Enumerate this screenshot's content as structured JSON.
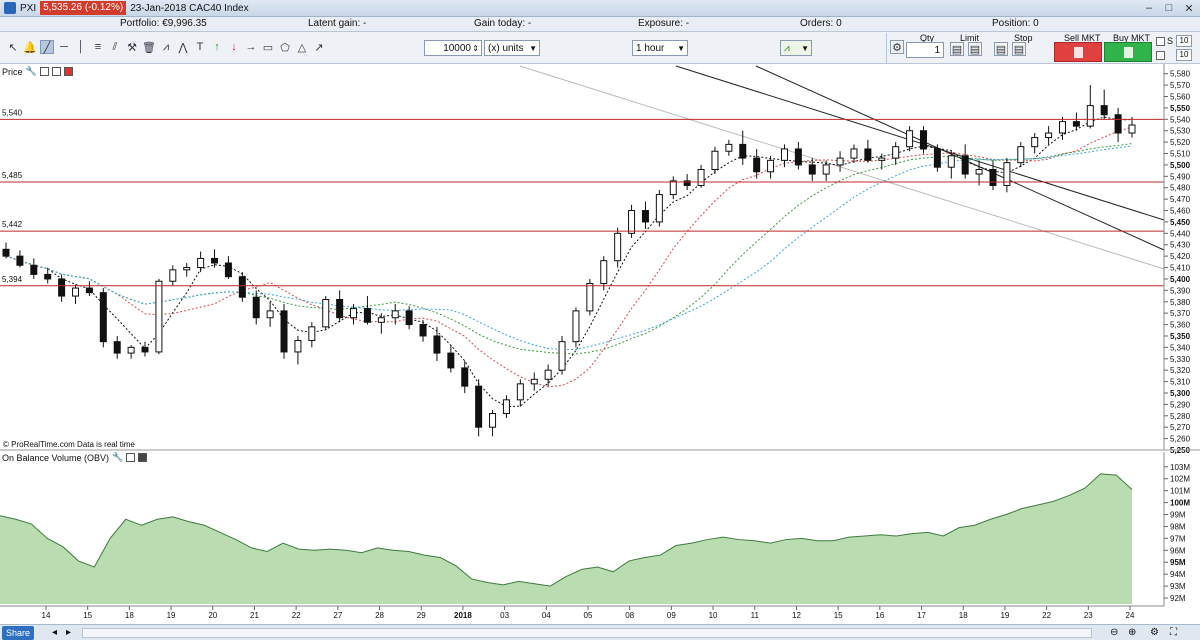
{
  "window": {
    "app_label": "PXI",
    "price_badge": "5,535.26 (-0.12%)",
    "subtitle": "23-Jan-2018 CAC40 Index",
    "controls": [
      "–",
      "□",
      "✕"
    ]
  },
  "portfolio_bar": {
    "portfolio": "Portfolio: €9,996.35",
    "latent_gain": "Latent gain:  -",
    "gain_today": "Gain today:  -",
    "exposure": "Exposure:  -",
    "orders": "Orders: 0",
    "position": "Position: 0"
  },
  "toolbar": {
    "quantity": "10000",
    "units": "(x) units",
    "timeframe": "1 hour",
    "tools": [
      "pointer-icon",
      "alert-bell-icon",
      "trendline-icon",
      "horizontal-line-icon",
      "vertical-line-icon",
      "fibonacci-icon",
      "channel-icon",
      "hammer-icon",
      "delete-icon",
      "zigzag-icon",
      "pattern-icon",
      "text-icon",
      "arrow-up-icon",
      "arrow-down-icon",
      "arrow-right-icon",
      "rectangle-icon",
      "polygon-icon",
      "triangle-icon",
      "fan-icon"
    ]
  },
  "trade_panel": {
    "qty_label": "Qty",
    "qty_value": "1",
    "limit_label": "Limit",
    "stop_label": "Stop",
    "sell_label": "Sell MKT",
    "buy_label": "Buy MKT",
    "s_label": "S",
    "s_value": "10",
    "t_value": "10"
  },
  "price_panel": {
    "label": "Price",
    "footer": "© ProRealTime.com  Data is real time",
    "level_labels": [
      "5,540",
      "5,485",
      "5,442",
      "5,394"
    ],
    "y_ticks": [
      "5,580",
      "5,570",
      "5,560",
      "5,550",
      "5,540",
      "5,530",
      "5,520",
      "5,510",
      "5,500",
      "5,490",
      "5,480",
      "5,470",
      "5,460",
      "5,450",
      "5,440",
      "5,430",
      "5,420",
      "5,410",
      "5,400",
      "5,390",
      "5,380",
      "5,370",
      "5,360",
      "5,350",
      "5,340",
      "5,330",
      "5,320",
      "5,310",
      "5,300",
      "5,290",
      "5,280",
      "5,270",
      "5,260",
      "5,250"
    ],
    "y_ticks_bold": [
      "5,550",
      "5,500",
      "5,450",
      "5,400",
      "5,350",
      "5,300",
      "5,250"
    ],
    "current_price_label": "5,535"
  },
  "obv_panel": {
    "label": "On Balance Volume (OBV)",
    "y_ticks": [
      "103M",
      "102M",
      "101M",
      "100M",
      "99M",
      "98M",
      "97M",
      "96M",
      "95M",
      "94M",
      "93M",
      "92M"
    ],
    "y_ticks_bold": [
      "100M",
      "95M"
    ],
    "current_label": "101M"
  },
  "x_axis": {
    "labels": [
      "14",
      "15",
      "18",
      "19",
      "20",
      "21",
      "22",
      "27",
      "28",
      "29",
      "2018",
      "03",
      "04",
      "05",
      "08",
      "09",
      "10",
      "11",
      "12",
      "15",
      "16",
      "17",
      "18",
      "19",
      "22",
      "23",
      "24"
    ],
    "bold": [
      "2018"
    ]
  },
  "chart_data": {
    "type": "candlestick",
    "instrument": "CAC40 Index",
    "timeframe": "1 hour",
    "ylim": [
      5250,
      5585
    ],
    "horizontal_levels": [
      5540,
      5485,
      5442,
      5394
    ],
    "candles": [
      [
        5426,
        5432,
        5418,
        5420
      ],
      [
        5420,
        5425,
        5410,
        5412
      ],
      [
        5412,
        5418,
        5400,
        5404
      ],
      [
        5404,
        5410,
        5396,
        5400
      ],
      [
        5400,
        5404,
        5380,
        5385
      ],
      [
        5385,
        5395,
        5378,
        5392
      ],
      [
        5392,
        5398,
        5385,
        5388
      ],
      [
        5388,
        5392,
        5340,
        5345
      ],
      [
        5345,
        5350,
        5330,
        5335
      ],
      [
        5335,
        5342,
        5330,
        5340
      ],
      [
        5340,
        5345,
        5332,
        5336
      ],
      [
        5336,
        5400,
        5334,
        5398
      ],
      [
        5398,
        5412,
        5394,
        5408
      ],
      [
        5408,
        5414,
        5402,
        5410
      ],
      [
        5410,
        5424,
        5406,
        5418
      ],
      [
        5418,
        5426,
        5410,
        5414
      ],
      [
        5414,
        5420,
        5400,
        5402
      ],
      [
        5402,
        5406,
        5380,
        5384
      ],
      [
        5384,
        5390,
        5360,
        5366
      ],
      [
        5366,
        5380,
        5358,
        5372
      ],
      [
        5372,
        5378,
        5330,
        5336
      ],
      [
        5336,
        5350,
        5325,
        5346
      ],
      [
        5346,
        5362,
        5340,
        5358
      ],
      [
        5358,
        5385,
        5355,
        5382
      ],
      [
        5382,
        5390,
        5362,
        5366
      ],
      [
        5366,
        5378,
        5360,
        5374
      ],
      [
        5374,
        5385,
        5360,
        5362
      ],
      [
        5362,
        5370,
        5352,
        5366
      ],
      [
        5366,
        5378,
        5360,
        5372
      ],
      [
        5372,
        5376,
        5356,
        5360
      ],
      [
        5360,
        5364,
        5345,
        5350
      ],
      [
        5350,
        5358,
        5328,
        5335
      ],
      [
        5335,
        5342,
        5318,
        5322
      ],
      [
        5322,
        5328,
        5300,
        5306
      ],
      [
        5306,
        5312,
        5262,
        5270
      ],
      [
        5270,
        5285,
        5262,
        5282
      ],
      [
        5282,
        5298,
        5278,
        5294
      ],
      [
        5294,
        5312,
        5288,
        5308
      ],
      [
        5308,
        5318,
        5302,
        5312
      ],
      [
        5312,
        5325,
        5306,
        5320
      ],
      [
        5320,
        5350,
        5316,
        5345
      ],
      [
        5345,
        5375,
        5340,
        5372
      ],
      [
        5372,
        5400,
        5368,
        5396
      ],
      [
        5396,
        5420,
        5390,
        5416
      ],
      [
        5416,
        5445,
        5410,
        5440
      ],
      [
        5440,
        5465,
        5436,
        5460
      ],
      [
        5460,
        5468,
        5444,
        5450
      ],
      [
        5450,
        5478,
        5446,
        5474
      ],
      [
        5474,
        5490,
        5470,
        5486
      ],
      [
        5486,
        5492,
        5478,
        5482
      ],
      [
        5482,
        5500,
        5480,
        5496
      ],
      [
        5496,
        5516,
        5492,
        5512
      ],
      [
        5512,
        5522,
        5508,
        5518
      ],
      [
        5518,
        5530,
        5500,
        5506
      ],
      [
        5506,
        5514,
        5488,
        5494
      ],
      [
        5494,
        5508,
        5488,
        5504
      ],
      [
        5504,
        5518,
        5498,
        5514
      ],
      [
        5514,
        5520,
        5496,
        5500
      ],
      [
        5500,
        5506,
        5486,
        5492
      ],
      [
        5492,
        5504,
        5486,
        5500
      ],
      [
        5500,
        5512,
        5494,
        5506
      ],
      [
        5506,
        5518,
        5502,
        5514
      ],
      [
        5514,
        5522,
        5502,
        5504
      ],
      [
        5504,
        5510,
        5496,
        5506
      ],
      [
        5506,
        5520,
        5500,
        5516
      ],
      [
        5516,
        5534,
        5512,
        5530
      ],
      [
        5530,
        5534,
        5510,
        5514
      ],
      [
        5514,
        5518,
        5494,
        5498
      ],
      [
        5498,
        5512,
        5488,
        5508
      ],
      [
        5508,
        5518,
        5488,
        5492
      ],
      [
        5492,
        5504,
        5482,
        5496
      ],
      [
        5496,
        5504,
        5478,
        5482
      ],
      [
        5482,
        5506,
        5476,
        5502
      ],
      [
        5502,
        5520,
        5498,
        5516
      ],
      [
        5516,
        5528,
        5510,
        5524
      ],
      [
        5524,
        5534,
        5518,
        5528
      ],
      [
        5528,
        5542,
        5522,
        5538
      ],
      [
        5538,
        5546,
        5530,
        5534
      ],
      [
        5534,
        5570,
        5532,
        5552
      ],
      [
        5552,
        5566,
        5540,
        5544
      ],
      [
        5544,
        5550,
        5520,
        5528
      ],
      [
        5528,
        5542,
        5524,
        5535
      ]
    ],
    "obv_ylim": [
      91.5,
      103.4
    ],
    "obv_values": [
      98.9,
      98.6,
      98.2,
      97.0,
      96.3,
      95.1,
      94.6,
      97.0,
      98.6,
      98.1,
      98.6,
      98.8,
      98.4,
      98.1,
      97.5,
      96.9,
      96.2,
      95.9,
      96.6,
      96.1,
      96.0,
      96.1,
      96.0,
      95.8,
      96.2,
      96.0,
      95.9,
      95.6,
      95.4,
      94.7,
      93.6,
      93.3,
      93.1,
      93.4,
      93.2,
      93.0,
      93.8,
      94.4,
      94.6,
      94.2,
      95.1,
      95.4,
      95.6,
      96.4,
      96.6,
      96.9,
      97.1,
      96.9,
      96.8,
      96.6,
      96.9,
      97.0,
      96.8,
      96.8,
      97.1,
      97.2,
      97.3,
      97.2,
      97.4,
      97.5,
      97.2,
      97.9,
      98.1,
      98.6,
      99.0,
      99.5,
      99.8,
      100.1,
      100.6,
      101.2,
      102.4,
      102.3,
      101.1
    ]
  }
}
